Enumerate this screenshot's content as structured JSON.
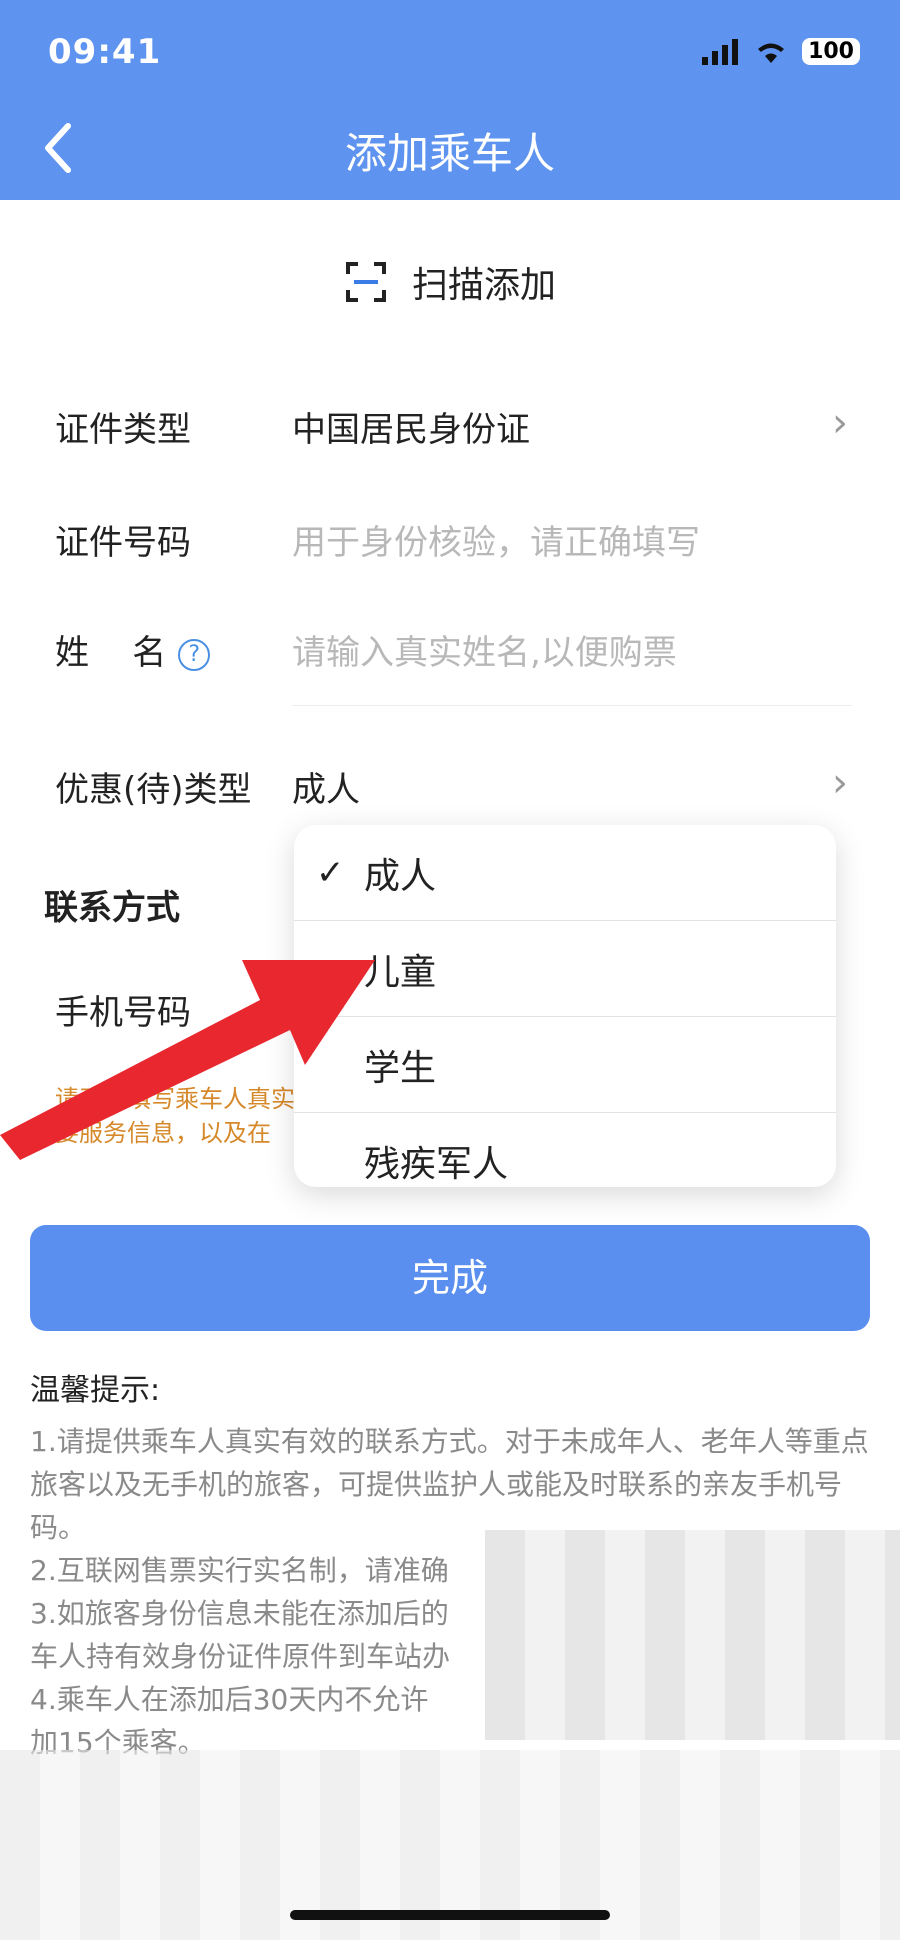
{
  "status_bar": {
    "time": "09:41",
    "battery": "100"
  },
  "header": {
    "title": "添加乘车人"
  },
  "scan": {
    "label": "扫描添加"
  },
  "form": {
    "id_type": {
      "label": "证件类型",
      "value": "中国居民身份证"
    },
    "id_number": {
      "label": "证件号码",
      "placeholder": "用于身份核验，请正确填写"
    },
    "name": {
      "label": "姓    名",
      "placeholder": "请输入真实姓名,以便购票"
    },
    "discount": {
      "label": "优惠(待)类型",
      "value": "成人"
    }
  },
  "contact": {
    "title": "联系方式",
    "phone_label": "手机号码",
    "note_line1": "请正确填写乘车人真实",
    "note_line2": "要服务信息，以及在"
  },
  "dropdown": {
    "options": [
      "成人",
      "儿童",
      "学生",
      "残疾军人"
    ],
    "selected": "成人"
  },
  "done_button": "完成",
  "tips": {
    "title": "温馨提示:",
    "items": [
      "1.请提供乘车人真实有效的联系方式。对于未成年人、老年人等重点旅客以及无手机的旅客，可提供监护人或能及时联系的亲友手机号码。",
      "2.互联网售票实行实名制，请准确",
      "3.如旅客身份信息未能在添加后的",
      "车人持有效身份证件原件到车站办",
      "4.乘车人在添加后30天内不允许",
      "加15个乘客。"
    ]
  }
}
